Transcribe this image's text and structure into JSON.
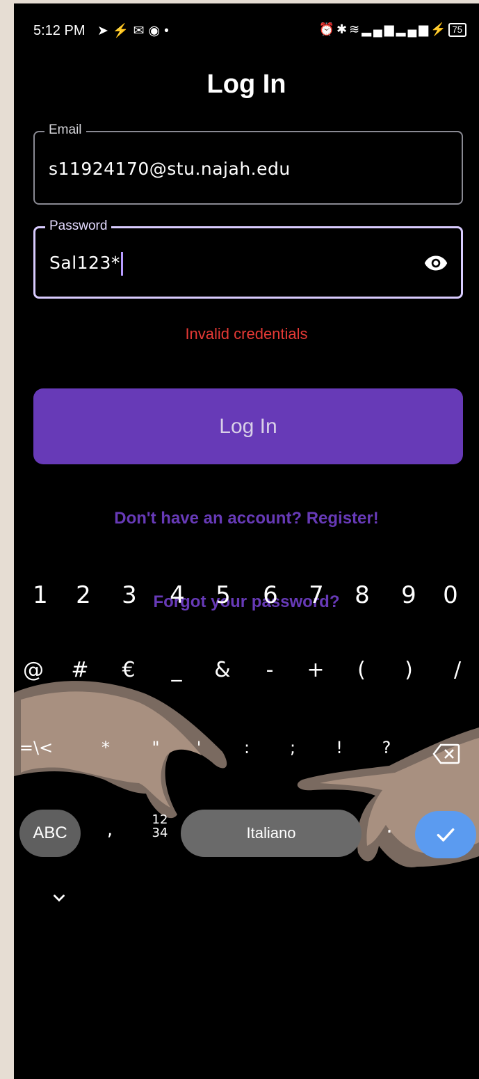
{
  "status_bar": {
    "time": "5:12 PM",
    "left_icons": [
      "telegram-icon",
      "messenger-icon",
      "gmail-icon",
      "viber-icon",
      "dot-icon"
    ],
    "right_icons": [
      "alarm-icon",
      "bluetooth-icon",
      "wifi-icon",
      "signal-icon",
      "signal-icon",
      "speed-icon",
      "charging-icon"
    ],
    "battery": "75"
  },
  "page": {
    "title": "Log In"
  },
  "email_field": {
    "label": "Email",
    "value": "s11924170@stu.najah.edu"
  },
  "password_field": {
    "label": "Password",
    "value": "Sal123*"
  },
  "error": "Invalid credentials",
  "login_button": "Log In",
  "register_link": "Don't have an account? Register!",
  "forgot_link": "Forgot your password?",
  "keyboard": {
    "number_row": [
      "1",
      "2",
      "3",
      "4",
      "5",
      "6",
      "7",
      "8",
      "9",
      "0"
    ],
    "symbol_row_1": [
      "@",
      "#",
      "€",
      "_",
      "&",
      "-",
      "+",
      "(",
      ")",
      "/"
    ],
    "symbol_row_2": [
      "=\\<",
      "*",
      "\"",
      "'",
      ":",
      ";",
      "!",
      "?"
    ],
    "abc_label": "ABC",
    "comma_label": ",",
    "numpad_label_top": "12",
    "numpad_label_bottom": "34",
    "space_label": "Italiano",
    "period_label": "."
  },
  "colors": {
    "accent": "#673ab7",
    "error": "#e53935",
    "enter_key": "#5b9bf0",
    "background": "#000000"
  }
}
